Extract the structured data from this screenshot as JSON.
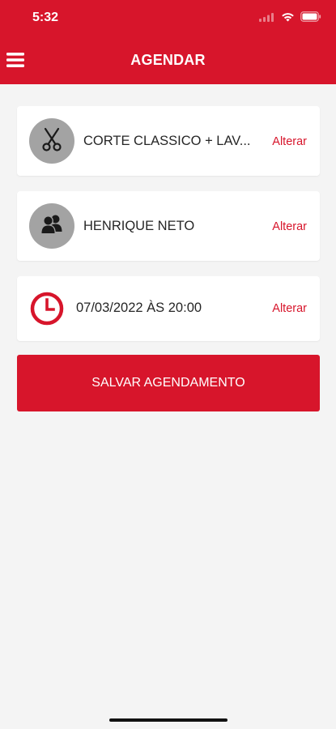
{
  "status_bar": {
    "time": "5:32"
  },
  "header": {
    "title": "AGENDAR",
    "menu_icon": "hamburger-icon"
  },
  "cards": {
    "service": {
      "icon": "scissors-icon",
      "text": "CORTE CLASSICO + LAV...",
      "action_label": "Alterar"
    },
    "professional": {
      "icon": "users-icon",
      "text": "HENRIQUE NETO",
      "action_label": "Alterar"
    },
    "datetime": {
      "icon": "clock-icon",
      "text": "07/03/2022 ÀS 20:00",
      "action_label": "Alterar"
    }
  },
  "save_button": {
    "label": "SALVAR AGENDAMENTO"
  },
  "colors": {
    "accent": "#d7152b",
    "background": "#f4f4f4",
    "card": "#ffffff",
    "avatar": "#a3a3a3",
    "text": "#262626"
  }
}
